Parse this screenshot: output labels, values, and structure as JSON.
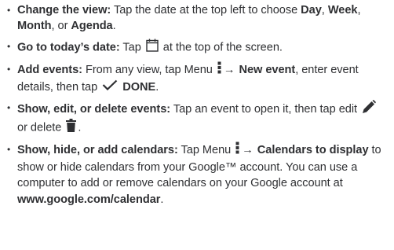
{
  "items": [
    {
      "title": "Change the view:",
      "t1": " Tap the date at the top left to choose ",
      "day": "Day",
      "c1": ", ",
      "week": "Week",
      "c2": ", ",
      "month": "Month",
      "or": ", or ",
      "agenda": "Agenda",
      "end": "."
    },
    {
      "title": "Go to today’s date:",
      "t1": " Tap ",
      "icon": "calendar-today-icon",
      "t2": " at the top of the screen."
    },
    {
      "title": "Add events:",
      "t1": " From any view, tap Menu ",
      "menu_icon": "menu-dots-icon",
      "arrow": "→",
      "new_event": "New event",
      "t2": ", enter event details, then tap ",
      "check_icon": "checkmark-icon",
      "done": "DONE",
      "end": "."
    },
    {
      "title": "Show, edit, or delete events:",
      "t1": " Tap an event to open it, then tap edit ",
      "edit_icon": "pencil-icon",
      "t2": " or delete ",
      "delete_icon": "trash-icon",
      "end": "."
    },
    {
      "title": "Show, hide, or add calendars:",
      "t1": " Tap Menu ",
      "menu_icon": "menu-dots-icon",
      "arrow": "→",
      "calendars": "Calendars to display",
      "t2": " to show or hide calendars from your Google™ account. You can use a computer to add or remove calendars on your Google account at ",
      "url": "www.google.com/calendar",
      "end": "."
    }
  ],
  "bullet_char": "•"
}
